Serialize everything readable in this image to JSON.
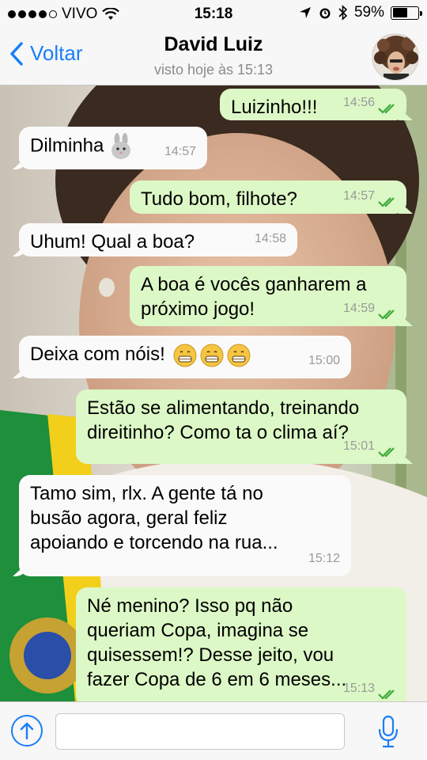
{
  "status": {
    "carrier": "VIVO",
    "time": "15:18",
    "battery": "59%",
    "battery_level": 0.59
  },
  "header": {
    "back_label": "Voltar",
    "contact_name": "David Luiz",
    "last_seen": "visto hoje às 15:13"
  },
  "messages": [
    {
      "dir": "out",
      "lines": [
        "Luizinho!!!"
      ],
      "time": "14:56"
    },
    {
      "dir": "in",
      "lines": [
        "Dilminha"
      ],
      "time": "14:57"
    },
    {
      "dir": "out",
      "lines": [
        "Tudo bom, filhote?"
      ],
      "time": "14:57"
    },
    {
      "dir": "in",
      "lines": [
        "Uhum! Qual a boa?"
      ],
      "time": "14:58"
    },
    {
      "dir": "out",
      "lines": [
        "A boa é vocês ganharem a",
        "próximo jogo!"
      ],
      "time": "14:59"
    },
    {
      "dir": "in",
      "lines": [
        "Deixa com nóis!"
      ],
      "time": "15:00"
    },
    {
      "dir": "out",
      "lines": [
        "Estão se alimentando, treinando",
        "direitinho? Como ta o clima aí?"
      ],
      "time": "15:01"
    },
    {
      "dir": "in",
      "lines": [
        "Tamo sim, rlx. A gente tá no",
        "busão agora, geral feliz",
        "apoiando e torcendo na rua..."
      ],
      "time": "15:12"
    },
    {
      "dir": "out",
      "lines": [
        "Né menino? Isso pq não",
        "queriam Copa, imagina se",
        "quisessem!? Desse jeito, vou",
        "fazer Copa de 6 em 6 meses..."
      ],
      "time": "15:13"
    }
  ],
  "composer": {
    "placeholder": ""
  },
  "icons": {
    "back": "chevron-left-icon",
    "upload": "arrow-up-circle-icon",
    "mic": "microphone-icon"
  },
  "colors": {
    "accent": "#1a7ef7",
    "outgoing_bubble": "#dcf8c6",
    "incoming_bubble": "#fafafa",
    "ticks": "#3daa3a"
  }
}
